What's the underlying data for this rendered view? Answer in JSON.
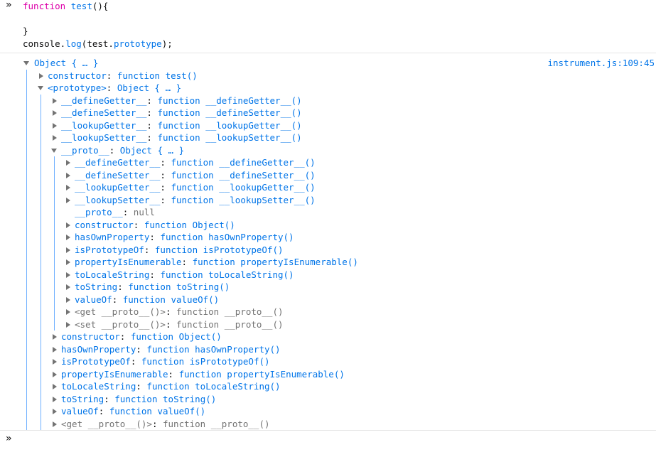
{
  "input": {
    "prompt_glyph": "»",
    "code_lines": [
      {
        "parts": [
          [
            "kw",
            "function"
          ],
          [
            "nm",
            " "
          ],
          [
            "fn",
            "test"
          ],
          [
            "nm",
            "(){"
          ]
        ]
      },
      {
        "parts": [
          [
            "nm",
            ""
          ]
        ]
      },
      {
        "parts": [
          [
            "nm",
            "}"
          ]
        ]
      },
      {
        "parts": [
          [
            "nm",
            "console."
          ],
          [
            "fn",
            "log"
          ],
          [
            "nm",
            "(test."
          ],
          [
            "prop",
            "prototype"
          ],
          [
            "nm",
            ");"
          ]
        ]
      }
    ]
  },
  "output": {
    "file_link": "instrument.js:109:45",
    "rows": [
      {
        "indent": 0,
        "toggle": "down",
        "parts": [
          [
            "fn",
            "Object { … }"
          ]
        ]
      },
      {
        "indent": 1,
        "toggle": "right",
        "parts": [
          [
            "prop",
            "constructor"
          ],
          [
            "nm",
            ": "
          ],
          [
            "fn",
            "function test()"
          ]
        ]
      },
      {
        "indent": 1,
        "toggle": "down",
        "parts": [
          [
            "prop",
            "<prototype>"
          ],
          [
            "nm",
            ": "
          ],
          [
            "fn",
            "Object { … }"
          ]
        ]
      },
      {
        "indent": 2,
        "toggle": "right",
        "parts": [
          [
            "prop",
            "__defineGetter__"
          ],
          [
            "nm",
            ": "
          ],
          [
            "fn",
            "function __defineGetter__()"
          ]
        ]
      },
      {
        "indent": 2,
        "toggle": "right",
        "parts": [
          [
            "prop",
            "__defineSetter__"
          ],
          [
            "nm",
            ": "
          ],
          [
            "fn",
            "function __defineSetter__()"
          ]
        ]
      },
      {
        "indent": 2,
        "toggle": "right",
        "parts": [
          [
            "prop",
            "__lookupGetter__"
          ],
          [
            "nm",
            ": "
          ],
          [
            "fn",
            "function __lookupGetter__()"
          ]
        ]
      },
      {
        "indent": 2,
        "toggle": "right",
        "parts": [
          [
            "prop",
            "__lookupSetter__"
          ],
          [
            "nm",
            ": "
          ],
          [
            "fn",
            "function __lookupSetter__()"
          ]
        ]
      },
      {
        "indent": 2,
        "toggle": "down",
        "parts": [
          [
            "prop",
            "__proto__"
          ],
          [
            "nm",
            ": "
          ],
          [
            "fn",
            "Object { … }"
          ]
        ]
      },
      {
        "indent": 3,
        "toggle": "right",
        "parts": [
          [
            "prop",
            "__defineGetter__"
          ],
          [
            "nm",
            ": "
          ],
          [
            "fn",
            "function __defineGetter__()"
          ]
        ]
      },
      {
        "indent": 3,
        "toggle": "right",
        "parts": [
          [
            "prop",
            "__defineSetter__"
          ],
          [
            "nm",
            ": "
          ],
          [
            "fn",
            "function __defineSetter__()"
          ]
        ]
      },
      {
        "indent": 3,
        "toggle": "right",
        "parts": [
          [
            "prop",
            "__lookupGetter__"
          ],
          [
            "nm",
            ": "
          ],
          [
            "fn",
            "function __lookupGetter__()"
          ]
        ]
      },
      {
        "indent": 3,
        "toggle": "right",
        "parts": [
          [
            "prop",
            "__lookupSetter__"
          ],
          [
            "nm",
            ": "
          ],
          [
            "fn",
            "function __lookupSetter__()"
          ]
        ]
      },
      {
        "indent": 3,
        "toggle": "none",
        "parts": [
          [
            "prop",
            "__proto__"
          ],
          [
            "nm",
            ": "
          ],
          [
            "grey",
            "null"
          ]
        ]
      },
      {
        "indent": 3,
        "toggle": "right",
        "parts": [
          [
            "prop",
            "constructor"
          ],
          [
            "nm",
            ": "
          ],
          [
            "fn",
            "function Object()"
          ]
        ]
      },
      {
        "indent": 3,
        "toggle": "right",
        "parts": [
          [
            "prop",
            "hasOwnProperty"
          ],
          [
            "nm",
            ": "
          ],
          [
            "fn",
            "function hasOwnProperty()"
          ]
        ]
      },
      {
        "indent": 3,
        "toggle": "right",
        "parts": [
          [
            "prop",
            "isPrototypeOf"
          ],
          [
            "nm",
            ": "
          ],
          [
            "fn",
            "function isPrototypeOf()"
          ]
        ]
      },
      {
        "indent": 3,
        "toggle": "right",
        "parts": [
          [
            "prop",
            "propertyIsEnumerable"
          ],
          [
            "nm",
            ": "
          ],
          [
            "fn",
            "function propertyIsEnumerable()"
          ]
        ]
      },
      {
        "indent": 3,
        "toggle": "right",
        "parts": [
          [
            "prop",
            "toLocaleString"
          ],
          [
            "nm",
            ": "
          ],
          [
            "fn",
            "function toLocaleString()"
          ]
        ]
      },
      {
        "indent": 3,
        "toggle": "right",
        "parts": [
          [
            "prop",
            "toString"
          ],
          [
            "nm",
            ": "
          ],
          [
            "fn",
            "function toString()"
          ]
        ]
      },
      {
        "indent": 3,
        "toggle": "right",
        "parts": [
          [
            "prop",
            "valueOf"
          ],
          [
            "nm",
            ": "
          ],
          [
            "fn",
            "function valueOf()"
          ]
        ]
      },
      {
        "indent": 3,
        "toggle": "right",
        "parts": [
          [
            "grey",
            "<get __proto__()>"
          ],
          [
            "nm",
            ": "
          ],
          [
            "grey",
            "function __proto__()"
          ]
        ]
      },
      {
        "indent": 3,
        "toggle": "right",
        "parts": [
          [
            "grey",
            "<set __proto__()>"
          ],
          [
            "nm",
            ": "
          ],
          [
            "grey",
            "function __proto__()"
          ]
        ]
      },
      {
        "indent": 2,
        "toggle": "right",
        "parts": [
          [
            "prop",
            "constructor"
          ],
          [
            "nm",
            ": "
          ],
          [
            "fn",
            "function Object()"
          ]
        ]
      },
      {
        "indent": 2,
        "toggle": "right",
        "parts": [
          [
            "prop",
            "hasOwnProperty"
          ],
          [
            "nm",
            ": "
          ],
          [
            "fn",
            "function hasOwnProperty()"
          ]
        ]
      },
      {
        "indent": 2,
        "toggle": "right",
        "parts": [
          [
            "prop",
            "isPrototypeOf"
          ],
          [
            "nm",
            ": "
          ],
          [
            "fn",
            "function isPrototypeOf()"
          ]
        ]
      },
      {
        "indent": 2,
        "toggle": "right",
        "parts": [
          [
            "prop",
            "propertyIsEnumerable"
          ],
          [
            "nm",
            ": "
          ],
          [
            "fn",
            "function propertyIsEnumerable()"
          ]
        ]
      },
      {
        "indent": 2,
        "toggle": "right",
        "parts": [
          [
            "prop",
            "toLocaleString"
          ],
          [
            "nm",
            ": "
          ],
          [
            "fn",
            "function toLocaleString()"
          ]
        ]
      },
      {
        "indent": 2,
        "toggle": "right",
        "parts": [
          [
            "prop",
            "toString"
          ],
          [
            "nm",
            ": "
          ],
          [
            "fn",
            "function toString()"
          ]
        ]
      },
      {
        "indent": 2,
        "toggle": "right",
        "parts": [
          [
            "prop",
            "valueOf"
          ],
          [
            "nm",
            ": "
          ],
          [
            "fn",
            "function valueOf()"
          ]
        ]
      },
      {
        "indent": 2,
        "toggle": "right",
        "parts": [
          [
            "grey",
            "<get __proto__()>"
          ],
          [
            "nm",
            ": "
          ],
          [
            "grey",
            "function __proto__()"
          ]
        ]
      }
    ]
  },
  "command_line": {
    "prompt_glyph": "»",
    "value": ""
  }
}
